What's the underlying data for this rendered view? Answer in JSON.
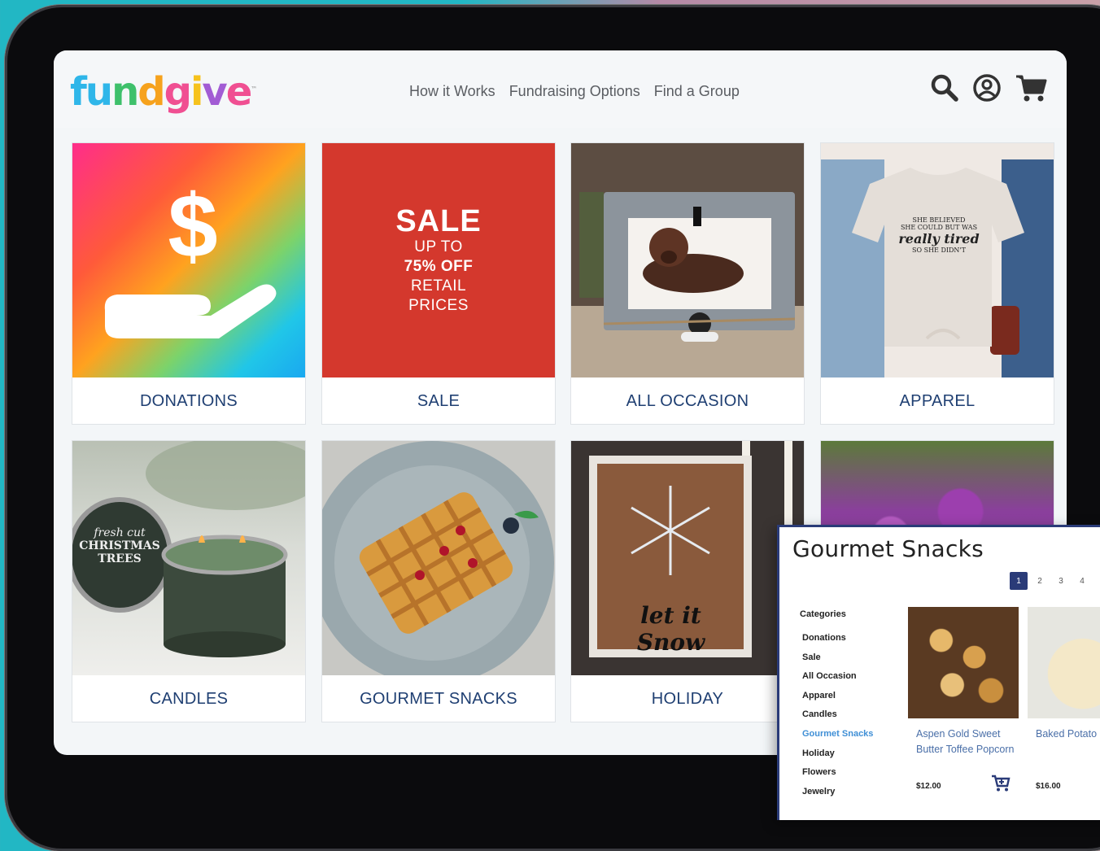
{
  "brand": {
    "logo_letters": [
      "f",
      "u",
      "n",
      "d",
      "g",
      "i",
      "v",
      "e"
    ],
    "logo_colors": [
      "#2fb6e9",
      "#2fb6e9",
      "#3ec06b",
      "#f6a21d",
      "#f04f92",
      "#f6c21d",
      "#a25cd4",
      "#f04f92"
    ],
    "trademark": "™"
  },
  "nav": {
    "items": [
      "How it Works",
      "Fundraising Options",
      "Find a Group"
    ]
  },
  "header_icons": [
    "search-icon",
    "account-icon",
    "cart-icon"
  ],
  "categories": [
    {
      "label": "DONATIONS",
      "image": "donation-hand-icon"
    },
    {
      "label": "SALE",
      "image": "sale-banner"
    },
    {
      "label": "ALL OCCASION",
      "image": "dog-photo-frame"
    },
    {
      "label": "APPAREL",
      "image": "tshirt-on-hangers"
    },
    {
      "label": "CANDLES",
      "image": "christmas-candles"
    },
    {
      "label": "GOURMET SNACKS",
      "image": "waffle-plate"
    },
    {
      "label": "HOLIDAY",
      "image": "let-it-snow-sign"
    },
    {
      "label": "",
      "image": "purple-flowers"
    }
  ],
  "sale_banner": {
    "title": "SALE",
    "line1": "UP TO",
    "line2": "75% OFF",
    "line3": "RETAIL",
    "line4": "PRICES"
  },
  "apparel_shirt": {
    "line1": "SHE BELIEVED",
    "line2": "SHE COULD BUT WAS",
    "line3": "really tired",
    "line4": "SO SHE DIDN'T"
  },
  "candle_label": {
    "line1": "fresh cut",
    "line2": "CHRISTMAS",
    "line3": "TREES"
  },
  "holiday_sign": "let it Snow",
  "colors": {
    "nav_text": "#5a5d62",
    "card_label": "#1f3f72",
    "sale_red": "#d4382d",
    "panel_accent": "#2a3b78",
    "active_category": "#3f8fd6"
  },
  "panel": {
    "title": "Gourmet Snacks",
    "pages": [
      "1",
      "2",
      "3",
      "4"
    ],
    "active_page": "1",
    "categories_heading": "Categories",
    "category_items": [
      "Donations",
      "Sale",
      "All Occasion",
      "Apparel",
      "Candles",
      "Gourmet Snacks",
      "Holiday",
      "Flowers",
      "Jewelry"
    ],
    "active_category": "Gourmet Snacks",
    "products": [
      {
        "name": "Aspen Gold Sweet Butter Toffee Popcorn",
        "price": "$12.00"
      },
      {
        "name": "Baked Potato Mix",
        "price": "$16.00"
      }
    ]
  }
}
